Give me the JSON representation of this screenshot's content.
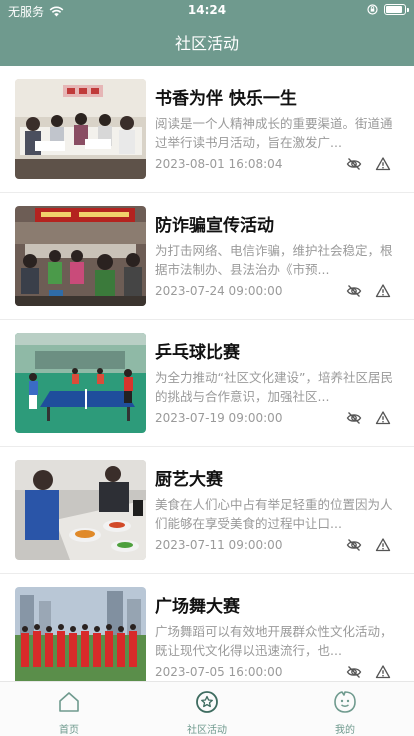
{
  "status_bar": {
    "carrier": "无服务",
    "time": "14:24"
  },
  "nav": {
    "title": "社区活动"
  },
  "activities": [
    {
      "title": "书香为伴 快乐一生",
      "description": "阅读是一个人精神成长的重要渠道。街道通过举行读书月活动，旨在激发广...",
      "time": "2023-08-01 16:08:04"
    },
    {
      "title": "防诈骗宣传活动",
      "description": "为打击网络、电信诈骗，维护社会稳定，根据市法制办、县法治办《市预...",
      "time": "2023-07-24 09:00:00"
    },
    {
      "title": "乒乓球比赛",
      "description": "为全力推动“社区文化建设”，培养社区居民的挑战与合作意识，加强社区...",
      "time": "2023-07-19 09:00:00"
    },
    {
      "title": "厨艺大赛",
      "description": "美食在人们心中占有举足轻重的位置因为人们能够在享受美食的过程中让口...",
      "time": "2023-07-11 09:00:00"
    },
    {
      "title": "广场舞大赛",
      "description": "广场舞蹈可以有效地开展群众性文化活动，既让现代文化得以迅速流行，也...",
      "time": "2023-07-05 16:00:00"
    }
  ],
  "tabs": [
    {
      "label": "首页",
      "icon": "home-icon"
    },
    {
      "label": "社区活动",
      "icon": "star-icon"
    },
    {
      "label": "我的",
      "icon": "smile-icon"
    }
  ],
  "colors": {
    "primary": "#6f9a8e",
    "muted_text": "#9a9a9a"
  }
}
